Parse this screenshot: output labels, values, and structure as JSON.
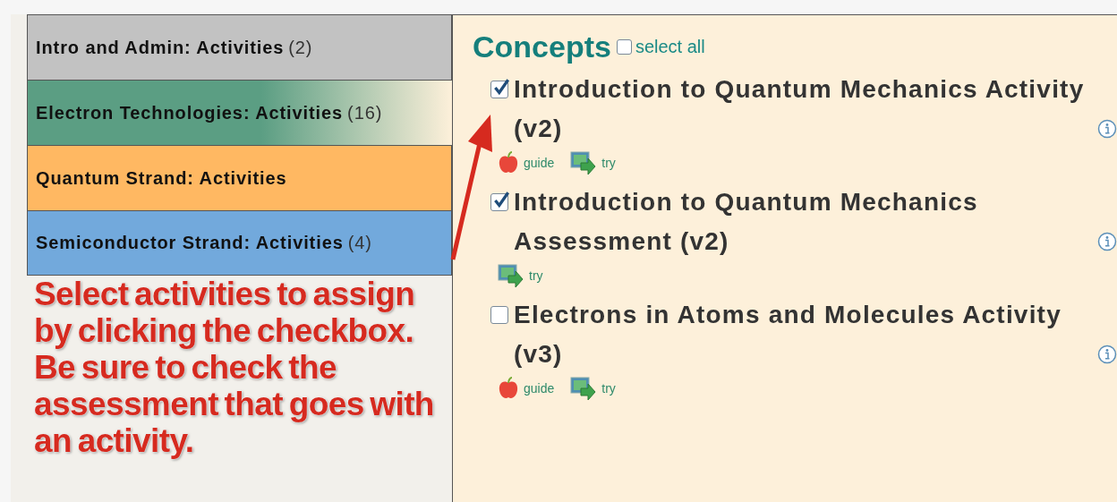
{
  "tabs": [
    {
      "label": "Intro and Admin: Activities",
      "count": "(2)",
      "color": "#c2c2c2",
      "selected": false
    },
    {
      "label": "Electron Technologies: Activities",
      "count": "(16)",
      "color": "#5b9e83",
      "selected": true
    },
    {
      "label": "Quantum Strand: Activities",
      "color": "#ffb862",
      "selected": false
    },
    {
      "label": "Semiconductor Strand: Activities",
      "count": "(4)",
      "color": "#72a9dc",
      "selected": false
    }
  ],
  "section": {
    "title": "Concepts",
    "select_all": {
      "label": "select all",
      "checked": false
    }
  },
  "activities": [
    {
      "title": "Introduction to Quantum Mechanics Activity (v2)",
      "checked": true,
      "links": [
        {
          "kind": "guide",
          "label": "guide"
        },
        {
          "kind": "try",
          "label": "try"
        }
      ]
    },
    {
      "title": "Introduction to Quantum Mechanics Assessment (v2)",
      "checked": true,
      "links": [
        {
          "kind": "try",
          "label": "try"
        }
      ]
    },
    {
      "title": "Electrons in Atoms and Molecules Activity (v3)",
      "checked": false,
      "links": [
        {
          "kind": "guide",
          "label": "guide"
        },
        {
          "kind": "try",
          "label": "try"
        }
      ]
    }
  ],
  "annotation": {
    "text": "Select activities to assign by clicking the checkbox. Be sure to check the assessment that goes with an activity."
  }
}
